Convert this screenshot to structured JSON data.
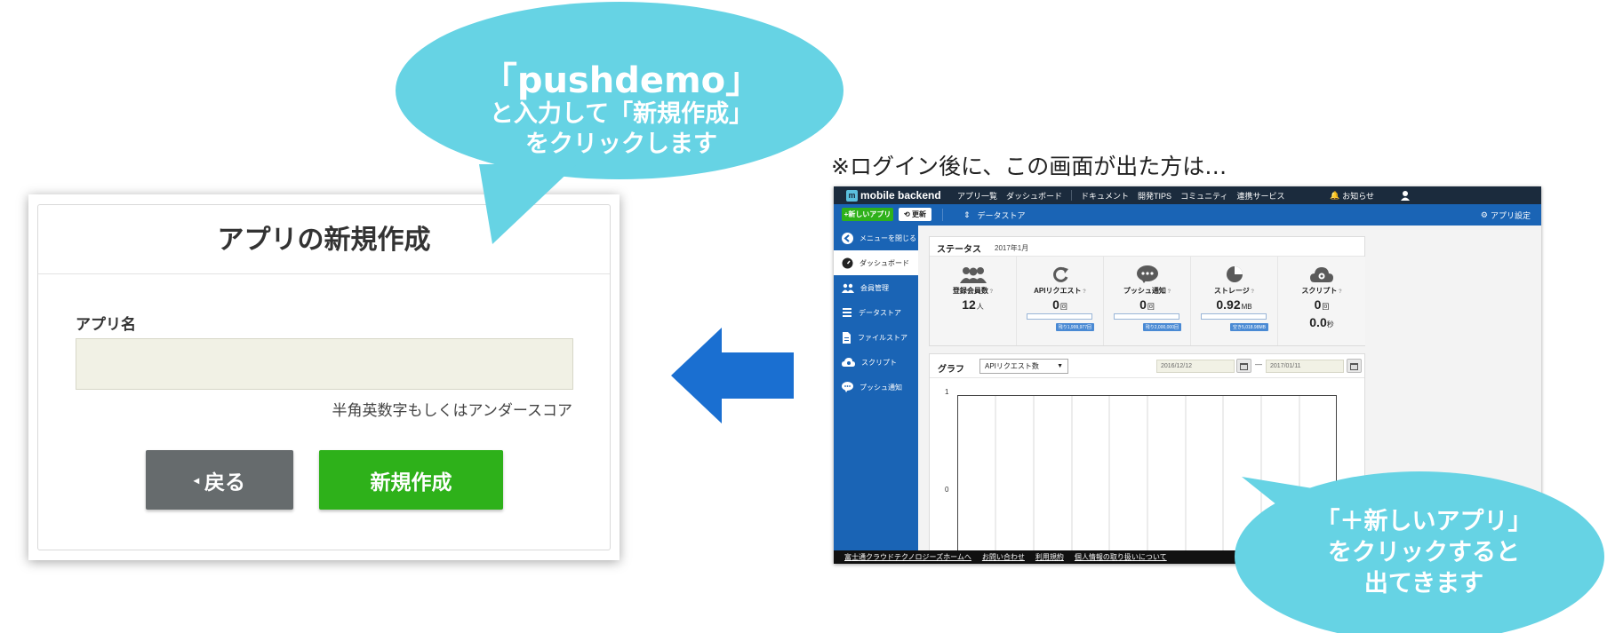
{
  "dialog": {
    "title": "アプリの新規作成",
    "field_label": "アプリ名",
    "input_value": "",
    "hint": "半角英数字もしくはアンダースコア",
    "back_label": "戻る",
    "create_label": "新規作成"
  },
  "callout_top": {
    "line1": "「pushdemo」",
    "line2": "と入力して「新規作成」",
    "line3": "をクリックします",
    "color": "#66d3e4"
  },
  "callout_bottom": {
    "line1": "「＋新しいアプリ」",
    "line2": "をクリックすると",
    "line3": "出てきます",
    "color": "#66d3e4"
  },
  "note": "※ログイン後に、この画面が出た方は…",
  "arrow_color": "#1a6fd1",
  "screenshot": {
    "brand": "mobile backend",
    "nav": [
      "アプリ一覧",
      "ダッシュボード",
      "ドキュメント",
      "開発TIPS",
      "コミュニティ",
      "連携サービス"
    ],
    "notice": "お知らせ",
    "new_app_label": "+新しいアプリ",
    "refresh_label": "更新",
    "app_name": "データストア",
    "app_settings": "アプリ設定",
    "sidebar": [
      {
        "label": "メニューを閉じる",
        "icon": "back-circle-icon"
      },
      {
        "label": "ダッシュボード",
        "icon": "dashboard-icon"
      },
      {
        "label": "会員管理",
        "icon": "users-icon"
      },
      {
        "label": "データストア",
        "icon": "datastore-icon"
      },
      {
        "label": "ファイルストア",
        "icon": "file-icon"
      },
      {
        "label": "スクリプト",
        "icon": "cloud-gear-icon"
      },
      {
        "label": "プッシュ通知",
        "icon": "chat-bubble-icon"
      }
    ],
    "status": {
      "title": "ステータス",
      "month": "2017年1月",
      "metrics": [
        {
          "label": "登録会員数",
          "value": "12",
          "unit": "人"
        },
        {
          "label": "APIリクエスト",
          "value": "0",
          "unit": "回",
          "tag": "残り1,999,977回"
        },
        {
          "label": "プッシュ通知",
          "value": "0",
          "unit": "回",
          "tag": "残り2,000,000回"
        },
        {
          "label": "ストレージ",
          "value": "0.92",
          "unit": "MB",
          "tag": "空き5,018.98MB"
        },
        {
          "label": "スクリプト",
          "value": "0",
          "unit": "回",
          "value2": "0.0",
          "unit2": "秒"
        }
      ]
    },
    "graph": {
      "title": "グラフ",
      "select": "APIリクエスト数",
      "date_from": "2016/12/12",
      "date_to": "2017/01/11",
      "dash": "—",
      "y_top": "1",
      "y_bottom": "0"
    },
    "footer": [
      "富士通クラウドテクノロジーズホームへ",
      "お問い合わせ",
      "利用規約",
      "個人情報の取り扱いについて"
    ]
  }
}
